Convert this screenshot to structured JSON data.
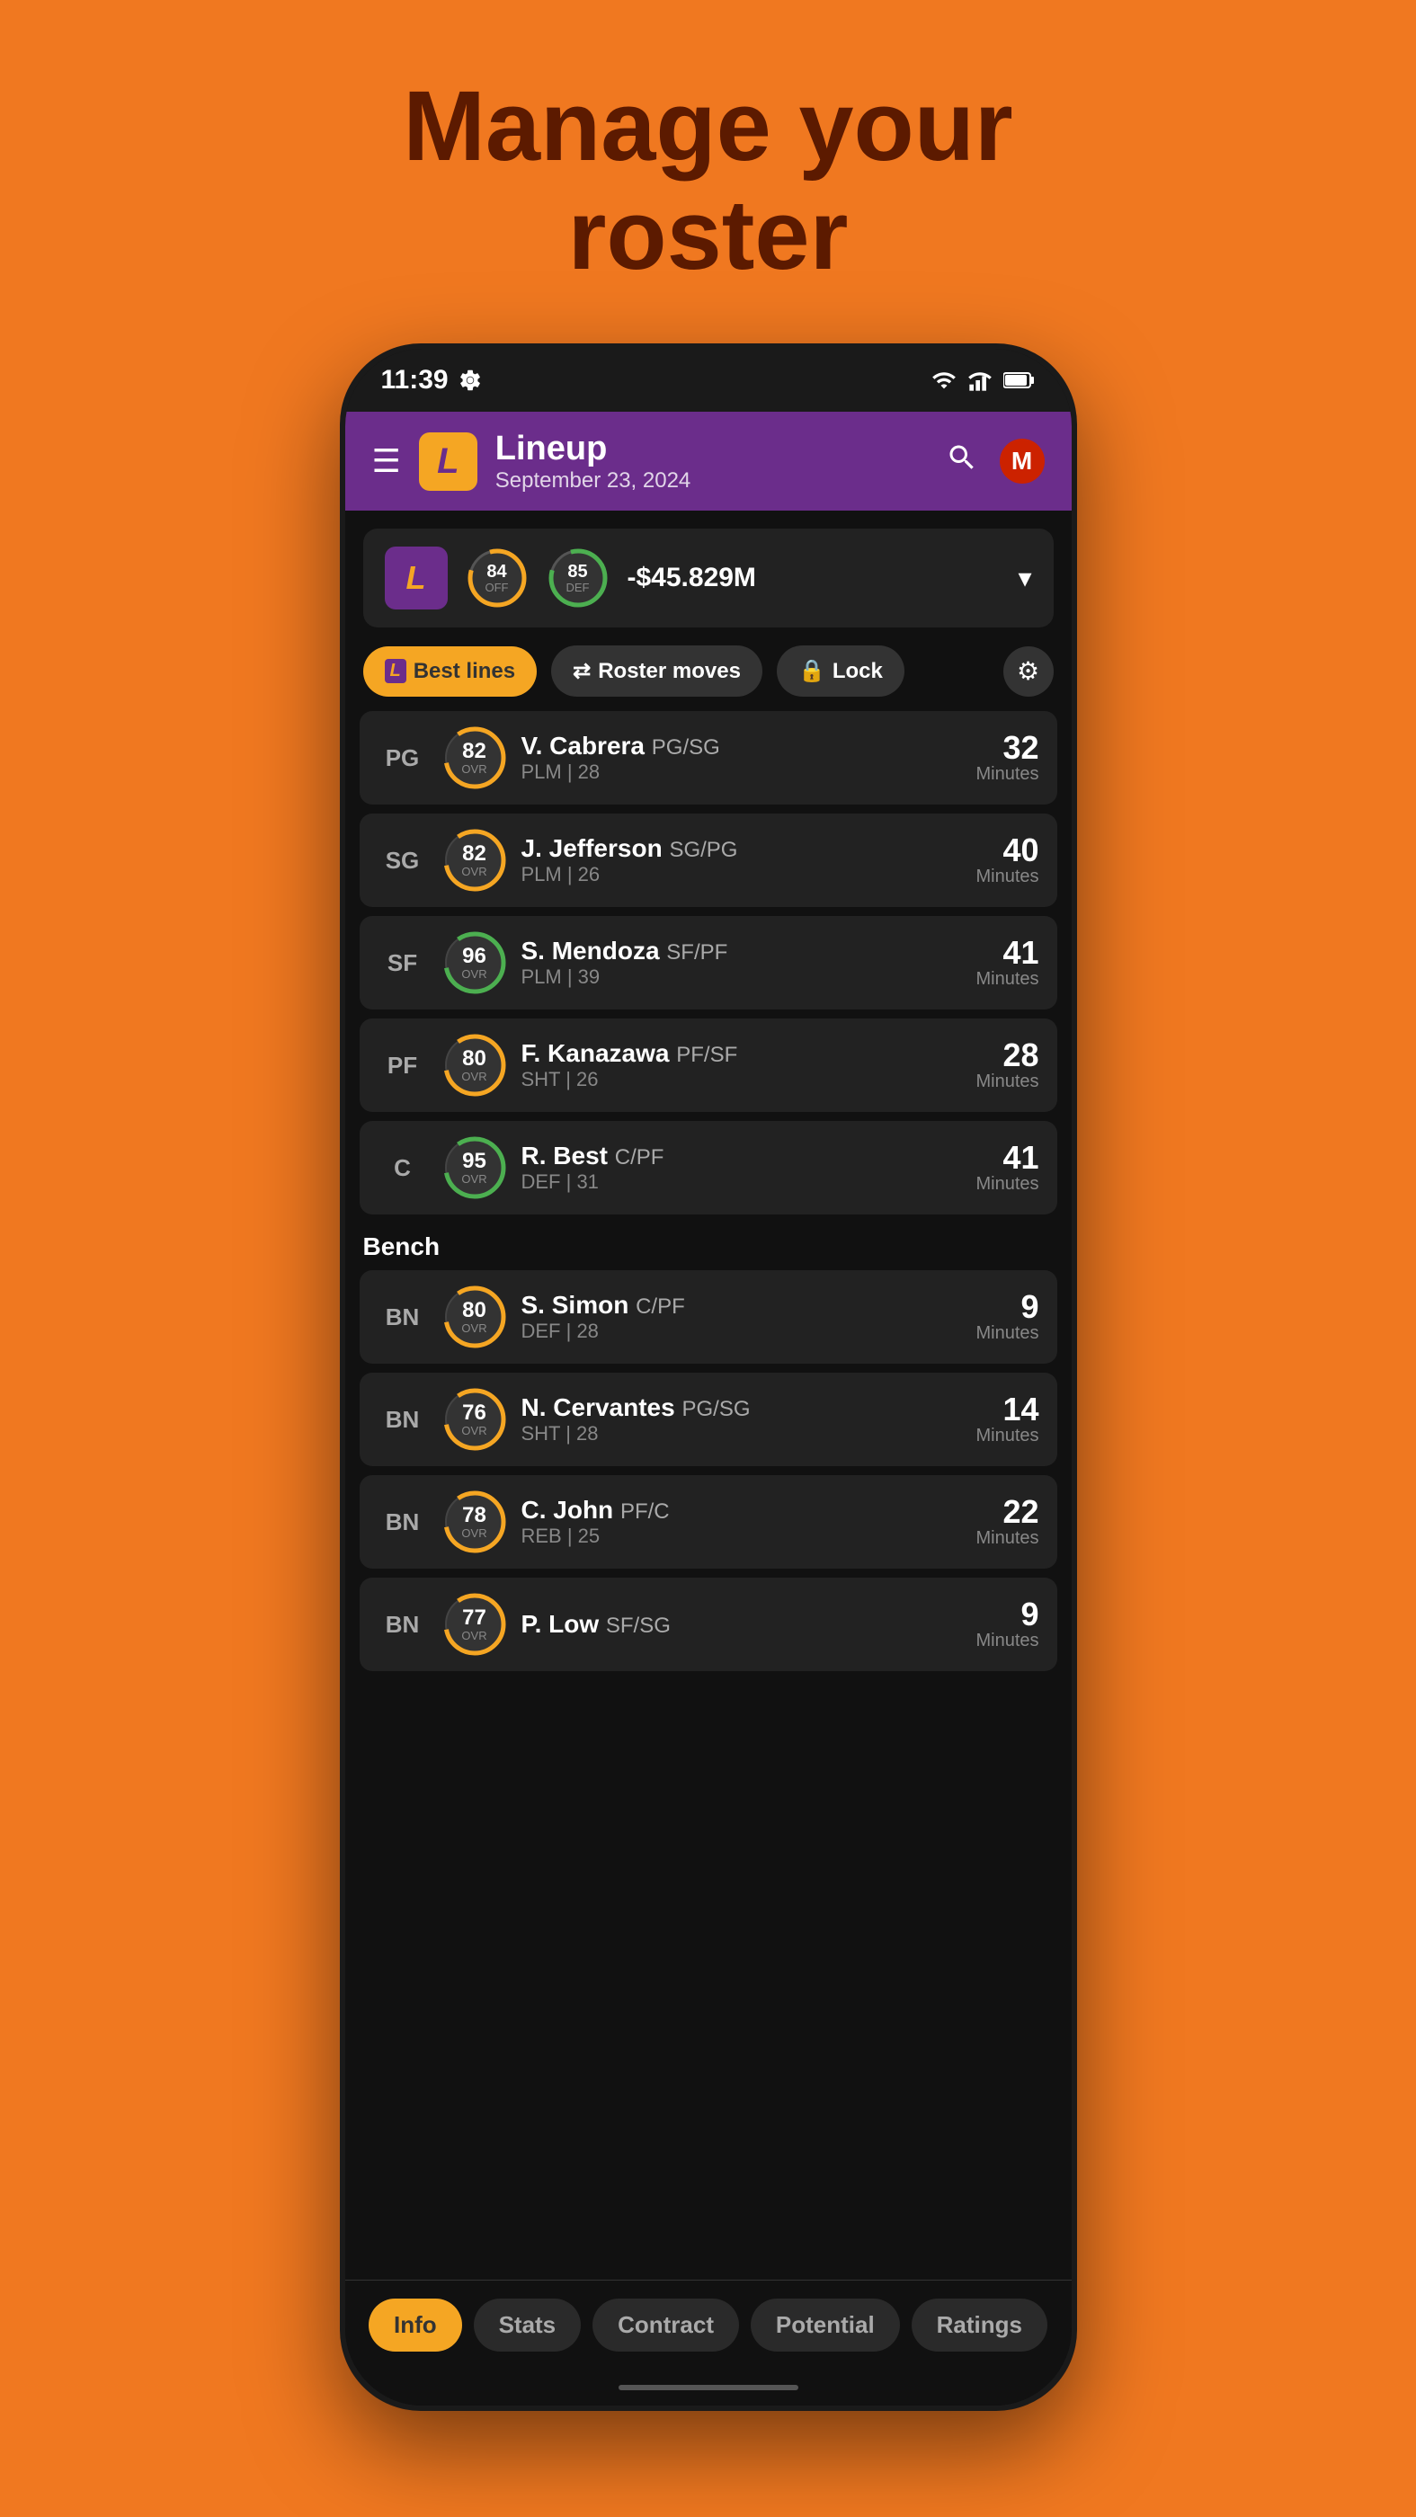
{
  "page": {
    "headline_line1": "Manage your",
    "headline_line2": "roster"
  },
  "status_bar": {
    "time": "11:39"
  },
  "header": {
    "menu_icon": "☰",
    "logo_letter": "L",
    "title": "Lineup",
    "subtitle": "September 23, 2024",
    "profile_letter": "M"
  },
  "team_stats": {
    "logo_letter": "L",
    "off_rating": "84",
    "off_label": "OFF",
    "def_rating": "85",
    "def_label": "DEF",
    "balance": "-$45.829M"
  },
  "action_buttons": {
    "best_lines": "Best lines",
    "roster_moves": "Roster moves",
    "lock": "Lock"
  },
  "starters": [
    {
      "position": "PG",
      "ovr": "82",
      "name": "V. Cabrera",
      "pos_type": "PG/SG",
      "detail": "PLM | 28",
      "minutes": "32",
      "ring_color": "#F5A623"
    },
    {
      "position": "SG",
      "ovr": "82",
      "name": "J. Jefferson",
      "pos_type": "SG/PG",
      "detail": "PLM | 26",
      "minutes": "40",
      "ring_color": "#F5A623"
    },
    {
      "position": "SF",
      "ovr": "96",
      "name": "S. Mendoza",
      "pos_type": "SF/PF",
      "detail": "PLM | 39",
      "minutes": "41",
      "ring_color": "#4CAF50"
    },
    {
      "position": "PF",
      "ovr": "80",
      "name": "F. Kanazawa",
      "pos_type": "PF/SF",
      "detail": "SHT | 26",
      "minutes": "28",
      "ring_color": "#F5A623"
    },
    {
      "position": "C",
      "ovr": "95",
      "name": "R. Best",
      "pos_type": "C/PF",
      "detail": "DEF | 31",
      "minutes": "41",
      "ring_color": "#4CAF50"
    }
  ],
  "bench_header": "Bench",
  "bench": [
    {
      "position": "BN",
      "ovr": "80",
      "name": "S. Simon",
      "pos_type": "C/PF",
      "detail": "DEF | 28",
      "minutes": "9",
      "ring_color": "#F5A623"
    },
    {
      "position": "BN",
      "ovr": "76",
      "name": "N. Cervantes",
      "pos_type": "PG/SG",
      "detail": "SHT | 28",
      "minutes": "14",
      "ring_color": "#F5A623"
    },
    {
      "position": "BN",
      "ovr": "78",
      "name": "C. John",
      "pos_type": "PF/C",
      "detail": "REB | 25",
      "minutes": "22",
      "ring_color": "#F5A623"
    },
    {
      "position": "BN",
      "ovr": "77",
      "name": "P. Low",
      "pos_type": "SF/SG",
      "detail": "",
      "minutes": "9",
      "ring_color": "#F5A623"
    }
  ],
  "tabs": [
    {
      "label": "Info",
      "active": true
    },
    {
      "label": "Stats",
      "active": false
    },
    {
      "label": "Contract",
      "active": false
    },
    {
      "label": "Potential",
      "active": false
    },
    {
      "label": "Ratings",
      "active": false
    }
  ]
}
